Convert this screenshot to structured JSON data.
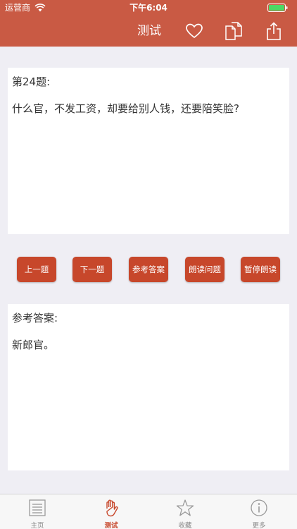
{
  "status_bar": {
    "carrier": "运营商",
    "time": "下午6:04"
  },
  "nav": {
    "title": "测试",
    "icons": [
      "heart-icon",
      "copy-icon",
      "share-icon"
    ]
  },
  "question": {
    "heading": "第24题:",
    "text": "什么官，不发工资，却要给别人钱，还要陪笑脸?"
  },
  "buttons": {
    "prev": "上一题",
    "next": "下一题",
    "answer": "参考答案",
    "read": "朗读问题",
    "pause": "暂停朗读"
  },
  "answer": {
    "heading": "参考答案:",
    "text": "新郎官。"
  },
  "tabbar": {
    "items": [
      {
        "label": "主页",
        "icon": "list-icon"
      },
      {
        "label": "测试",
        "icon": "hand-icon",
        "active": true
      },
      {
        "label": "收藏",
        "icon": "star-icon"
      },
      {
        "label": "更多",
        "icon": "info-icon"
      }
    ]
  },
  "colors": {
    "header": "#c95a44",
    "button": "#c7472b",
    "background": "#efeef4"
  }
}
